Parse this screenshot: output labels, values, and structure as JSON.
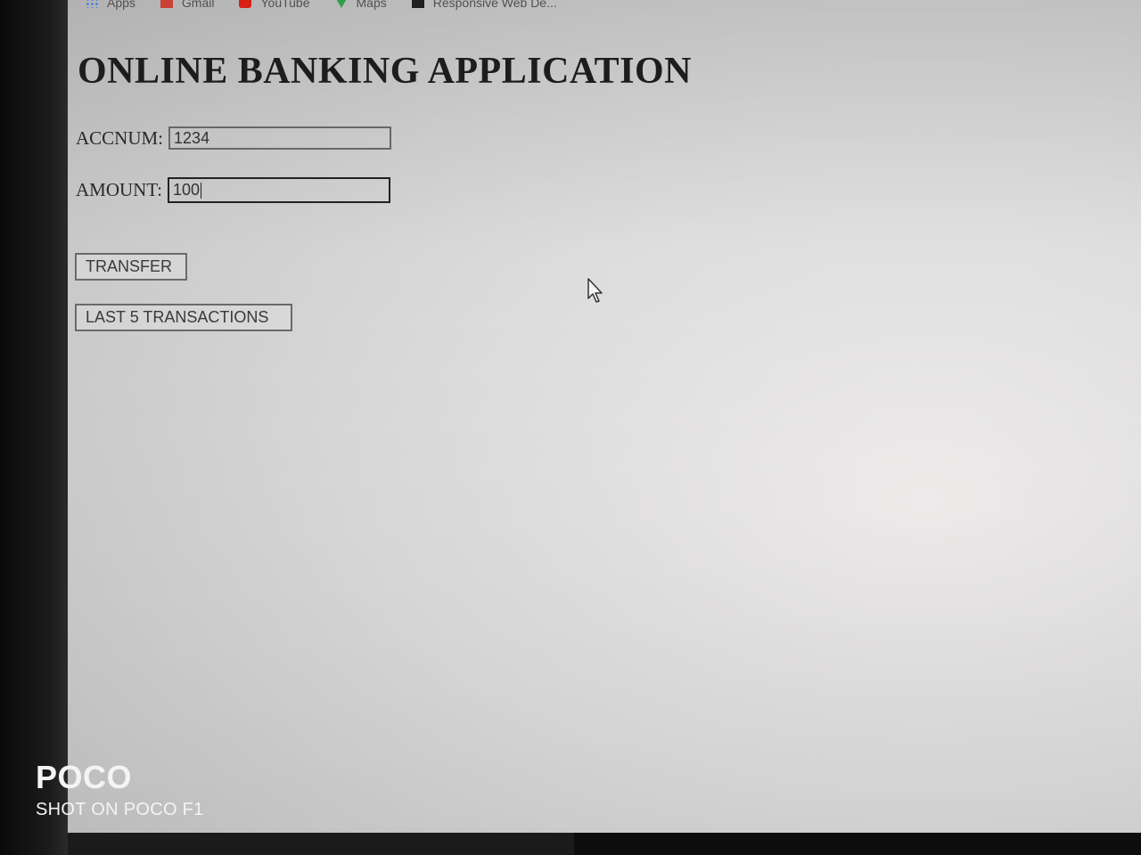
{
  "bookmarks": [
    {
      "label": "Apps",
      "icon": "apps-grid-icon"
    },
    {
      "label": "Gmail",
      "icon": "gmail-icon"
    },
    {
      "label": "YouTube",
      "icon": "youtube-icon"
    },
    {
      "label": "Maps",
      "icon": "maps-pin-icon"
    },
    {
      "label": "Responsive Web De...",
      "icon": "bookmark-site-icon"
    }
  ],
  "page": {
    "title": "ONLINE BANKING APPLICATION"
  },
  "form": {
    "acc_label": "ACCNUM:",
    "acc_value": "1234",
    "amount_label": "AMOUNT:",
    "amount_value": "100"
  },
  "buttons": {
    "transfer": "TRANSFER",
    "last5": "LAST 5 TRANSACTIONS"
  },
  "watermark": {
    "brand": "POCO",
    "sub": "SHOT ON POCO F1"
  },
  "colors": {
    "screen_bg": "#dcdcdc",
    "text": "#1e1e1e",
    "bezel": "#111111"
  }
}
